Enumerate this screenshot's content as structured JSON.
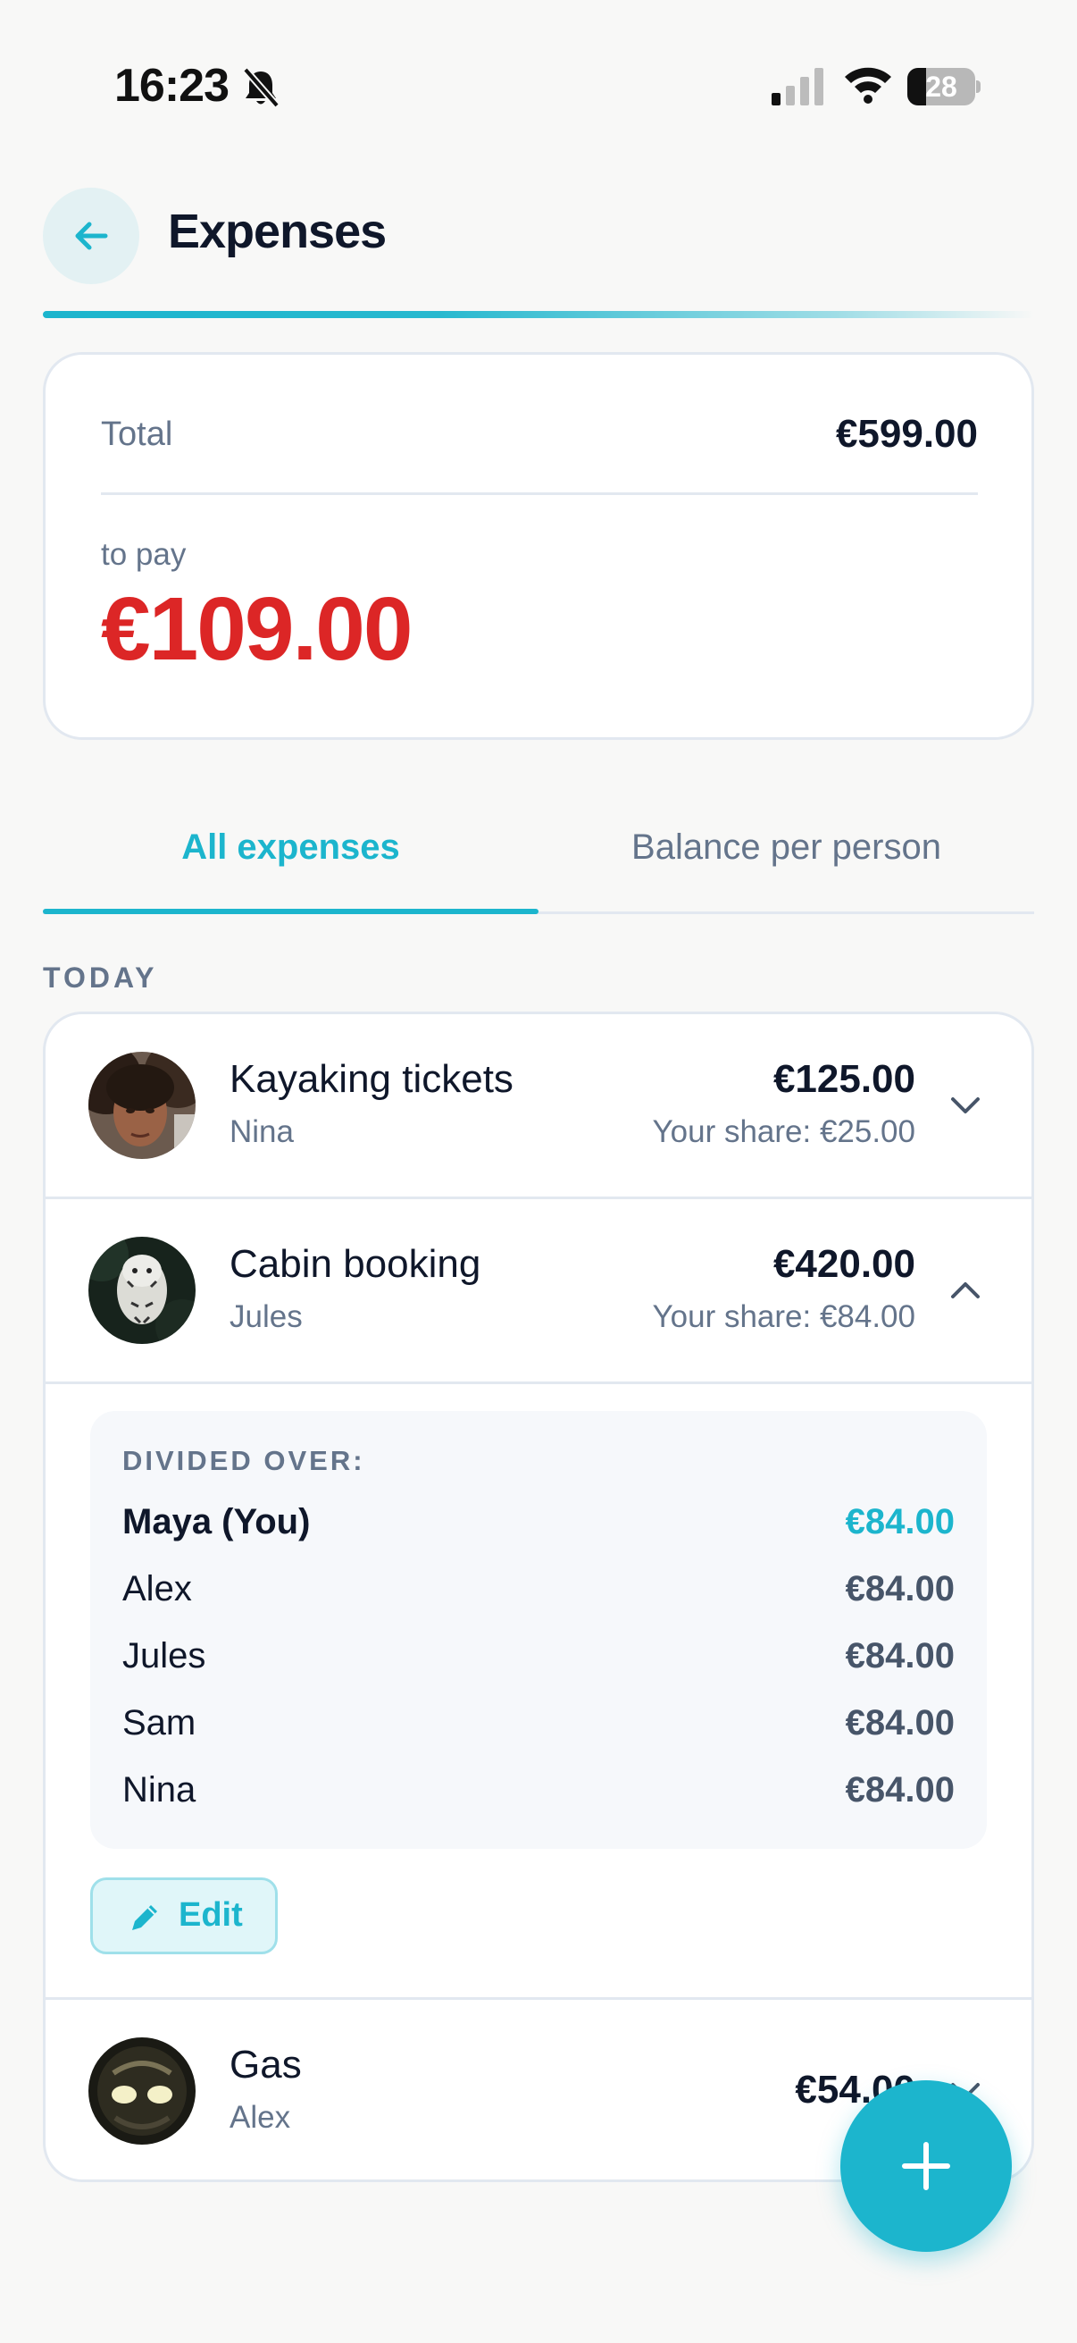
{
  "status_bar": {
    "time": "16:23",
    "battery": "28",
    "battery_level": 0.28
  },
  "header": {
    "title": "Expenses"
  },
  "summary": {
    "total_label": "Total",
    "total_value": "€599.00",
    "to_pay_label": "to pay",
    "to_pay_value": "€109.00"
  },
  "tabs": [
    {
      "label": "All expenses",
      "active": true
    },
    {
      "label": "Balance per person",
      "active": false
    }
  ],
  "section_label": "TODAY",
  "expenses": [
    {
      "title": "Kayaking tickets",
      "payer": "Nina",
      "amount": "€125.00",
      "share": "Your share: €25.00",
      "expanded": false
    },
    {
      "title": "Cabin booking",
      "payer": "Jules",
      "amount": "€420.00",
      "share": "Your share: €84.00",
      "expanded": true,
      "divided_label": "DIVIDED OVER:",
      "split": [
        {
          "name": "Maya (You)",
          "amount": "€84.00",
          "is_you": true
        },
        {
          "name": "Alex",
          "amount": "€84.00"
        },
        {
          "name": "Jules",
          "amount": "€84.00"
        },
        {
          "name": "Sam",
          "amount": "€84.00"
        },
        {
          "name": "Nina",
          "amount": "€84.00"
        }
      ],
      "edit_label": "Edit"
    },
    {
      "title": "Gas",
      "payer": "Alex",
      "amount": "€54.00",
      "expanded": false
    }
  ],
  "colors": {
    "accent": "#1cb5cd",
    "to_pay": "#dc2626",
    "text": "#0f172a",
    "muted": "#64748b"
  }
}
